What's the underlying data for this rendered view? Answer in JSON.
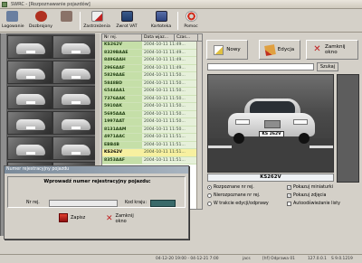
{
  "window": {
    "title": "SWRC - [Rozpoznawanie pojazdów]"
  },
  "toolbar": {
    "items": [
      {
        "label": "Logowanie",
        "icon": "user-icon"
      },
      {
        "label": "Dozbrojony",
        "icon": "stop-sign-icon"
      },
      {
        "label": "Zastrzeżenia",
        "icon": "notepad-icon"
      },
      {
        "label": "Zwrot VAT",
        "icon": "document-icon"
      },
      {
        "label": "Kartoteka",
        "icon": "cabinet-icon"
      },
      {
        "label": "Pomoc",
        "icon": "lifebuoy-icon"
      }
    ]
  },
  "plates_list": {
    "headers": [
      "Nr rej.",
      "Data wjaz...",
      "Czas..."
    ],
    "rows": [
      {
        "plate": "KS262V",
        "datetime": "2004-10-11 11:49..."
      },
      {
        "plate": "8329BAAE",
        "datetime": "2004-10-11 11:49..."
      },
      {
        "plate": "8496AAH",
        "datetime": "2004-10-11 11:49..."
      },
      {
        "plate": "2966AAF",
        "datetime": "2004-10-11 11:49..."
      },
      {
        "plate": "5829AAE",
        "datetime": "2004-10-11 11:50..."
      },
      {
        "plate": "5848BD",
        "datetime": "2004-10-11 11:50..."
      },
      {
        "plate": "6544AA1",
        "datetime": "2004-10-11 11:50..."
      },
      {
        "plate": "7376AAK",
        "datetime": "2004-10-11 11:50..."
      },
      {
        "plate": "5910AK",
        "datetime": "2004-10-11 11:50..."
      },
      {
        "plate": "5695AAA",
        "datetime": "2004-10-11 11:50..."
      },
      {
        "plate": "1997AAT",
        "datetime": "2004-10-11 11:50..."
      },
      {
        "plate": "8131AAM",
        "datetime": "2004-10-11 11:50..."
      },
      {
        "plate": "4971AAC",
        "datetime": "2004-10-11 11:51..."
      },
      {
        "plate": "EBB4B",
        "datetime": "2004-10-11 11:51..."
      },
      {
        "plate": "KS262V",
        "datetime": "2004-10-11 11:51..."
      },
      {
        "plate": "8353AAF",
        "datetime": "2004-10-11 11:51..."
      }
    ],
    "selected_index": 14
  },
  "actions": {
    "new_label": "Nowy",
    "edit_label": "Edycja",
    "close_label": "Zamknij okno",
    "search_label": "Szukaj"
  },
  "photo": {
    "plate_text": "KS 262V",
    "caption": "KS262V"
  },
  "options": {
    "recognized": "Rozpoznane nr rej.",
    "unrecognized": "Nierozpoznane nr rej.",
    "editing": "W trakcie edycji/odprawy",
    "show_thumbs": "Pokazuj miniaturki",
    "show_photos": "Pokazuj zdjęcia",
    "autoscroll": "Autoodświeżanie listy"
  },
  "dialog": {
    "title": "Numer rejestracyjny pojazdu",
    "prompt": "Wprowadź numer rejestracyjny pojazdu:",
    "nr_label": "Nr rej.",
    "kraj_label": "Kod kraju:",
    "save_label": "Zapisz",
    "close_label": "Zamknij okno"
  },
  "statusbar": {
    "time_range": "04-12-20 19:00 - 04-12-21 7:00",
    "user": "jacs",
    "mode": "[hf] Odprawa 01",
    "ip": "127.0.0.1",
    "version": "S 9.0.1219"
  },
  "colors": {
    "plate_bg": "#c5dfa8",
    "selected_bg": "#f7f0a0",
    "dialog_title": "#7a8a9a"
  }
}
